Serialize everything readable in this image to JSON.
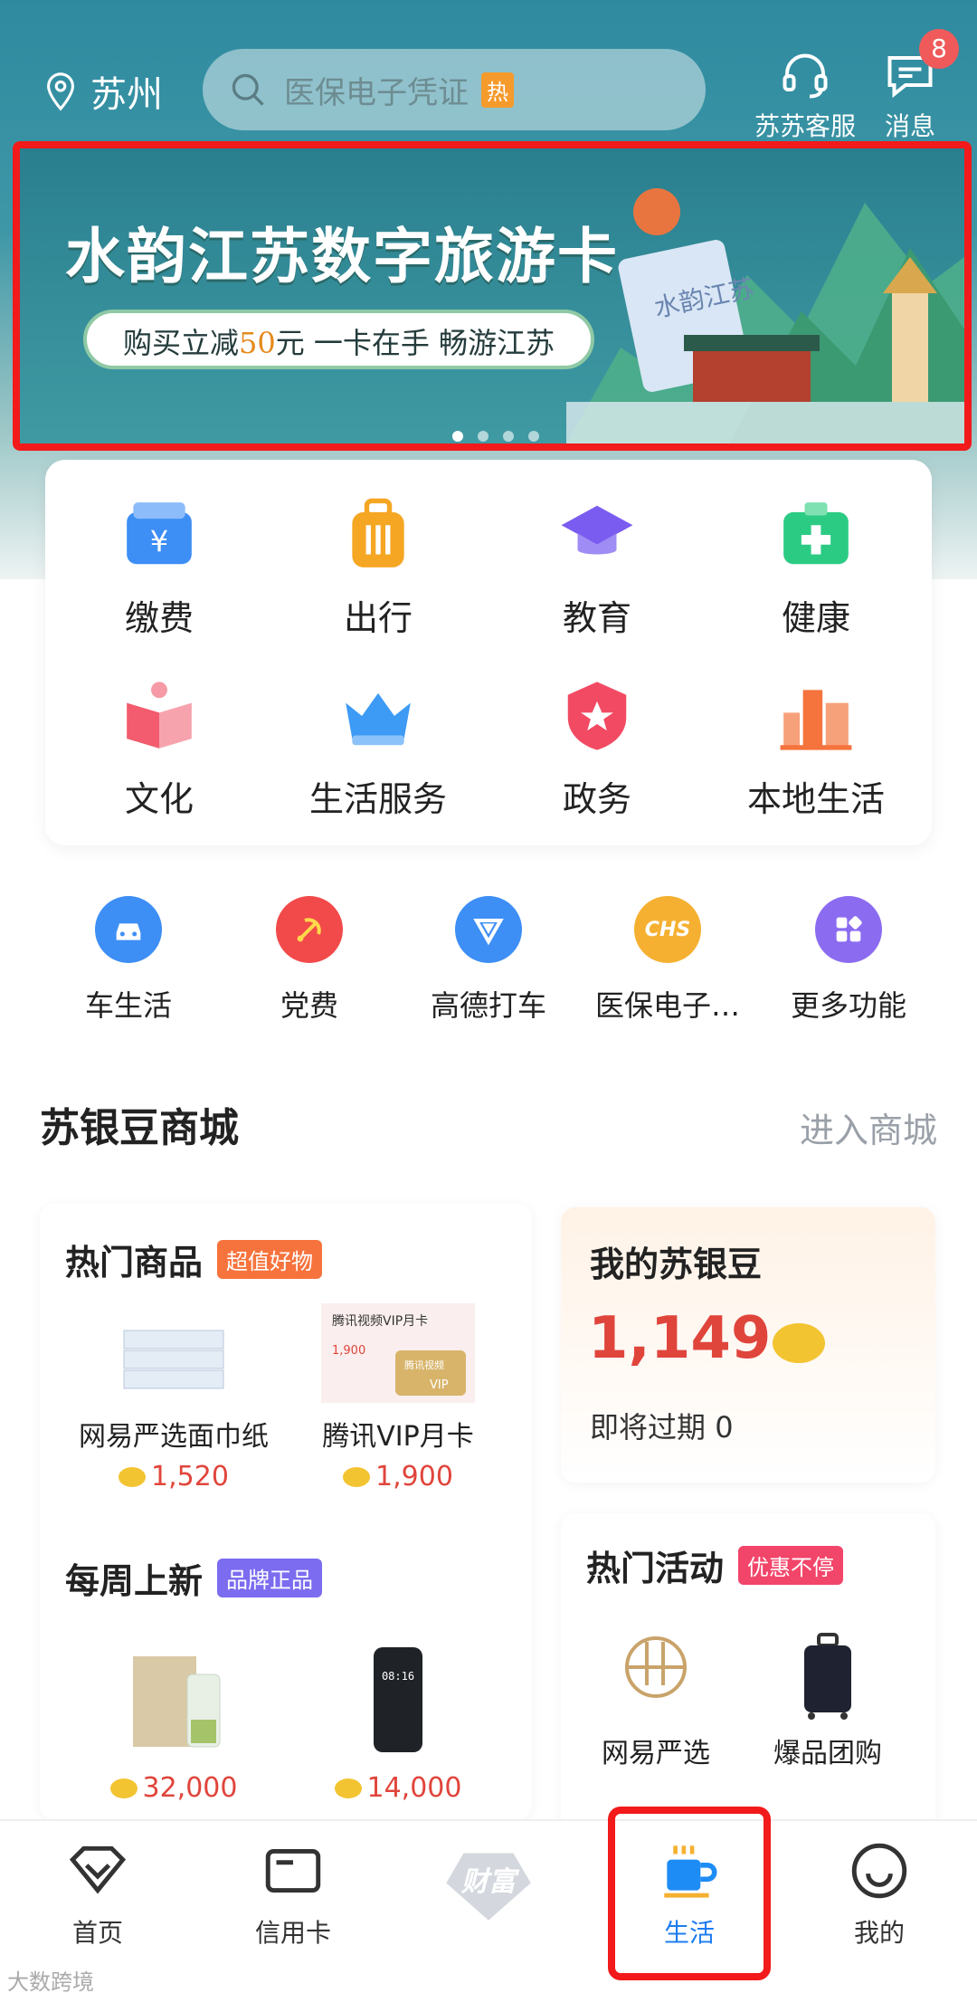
{
  "header": {
    "city": "苏州",
    "search_placeholder": "医保电子凭证",
    "search_hot": "热",
    "service_label": "苏苏客服",
    "message_label": "消息",
    "message_badge": "8"
  },
  "banner": {
    "title": "水韵江苏数字旅游卡",
    "pill_prefix": "购买立减",
    "pill_num": "50",
    "pill_suffix": "元 一卡在手 畅游江苏",
    "card_text": "水韵江苏",
    "page_count": 4,
    "active_page": 1
  },
  "categories": [
    {
      "label": "缴费",
      "icon": "payment-icon",
      "color": "#3d8ef5"
    },
    {
      "label": "出行",
      "icon": "luggage-icon",
      "color": "#f5a623"
    },
    {
      "label": "教育",
      "icon": "graduation-cap-icon",
      "color": "#7b5cf0"
    },
    {
      "label": "健康",
      "icon": "medical-kit-icon",
      "color": "#2ccb83"
    },
    {
      "label": "文化",
      "icon": "book-icon",
      "color": "#f25c6e"
    },
    {
      "label": "生活服务",
      "icon": "crown-icon",
      "color": "#3d9af5"
    },
    {
      "label": "政务",
      "icon": "badge-star-icon",
      "color": "#f24a63"
    },
    {
      "label": "本地生活",
      "icon": "city-buildings-icon",
      "color": "#f5733d"
    }
  ],
  "quick": [
    {
      "label": "车生活",
      "icon": "car-icon",
      "color": "#3d8ef5"
    },
    {
      "label": "党费",
      "icon": "party-icon",
      "color": "#f24a4a"
    },
    {
      "label": "高德打车",
      "icon": "navigation-icon",
      "color": "#3d8ef5"
    },
    {
      "label": "医保电子…",
      "icon": "chs-icon",
      "color": "#f5b031",
      "icon_text": "CHS"
    },
    {
      "label": "更多功能",
      "icon": "grid-icon",
      "color": "#8b6cf0"
    }
  ],
  "mall": {
    "title": "苏银豆商城",
    "link": "进入商城",
    "hot": {
      "title": "热门商品",
      "tag": "超值好物",
      "items": [
        {
          "name": "网易严选面巾纸",
          "price": "1,520"
        },
        {
          "name": "腾讯VIP月卡",
          "price": "1,900",
          "img_title": "腾讯视频VIP月卡",
          "img_price": "1,900",
          "img_brand": "腾讯视频",
          "img_vip": "VIP"
        }
      ]
    },
    "weekly": {
      "title": "每周上新",
      "tag": "品牌正品",
      "items": [
        {
          "name": "",
          "price": "32,000"
        },
        {
          "name": "",
          "price": "14,000",
          "img_text": "08:16"
        }
      ]
    },
    "beans": {
      "title": "我的苏银豆",
      "amount": "1,149",
      "expire_label": "即将过期",
      "expire_value": "0"
    },
    "activity": {
      "title": "热门活动",
      "tag": "优惠不停",
      "items": [
        {
          "name": "网易严选"
        },
        {
          "name": "爆品团购"
        }
      ]
    }
  },
  "tabs": [
    {
      "label": "首页",
      "icon": "home-diamond-icon"
    },
    {
      "label": "信用卡",
      "icon": "credit-card-icon"
    },
    {
      "label": "财富",
      "icon": "wealth-logo-icon"
    },
    {
      "label": "生活",
      "icon": "coffee-cup-icon",
      "active": true
    },
    {
      "label": "我的",
      "icon": "smiley-icon"
    }
  ],
  "watermark": "大数跨境",
  "colors": {
    "accent": "#1e7cf0",
    "price": "#e0453c",
    "highlight": "#f21a1a"
  }
}
